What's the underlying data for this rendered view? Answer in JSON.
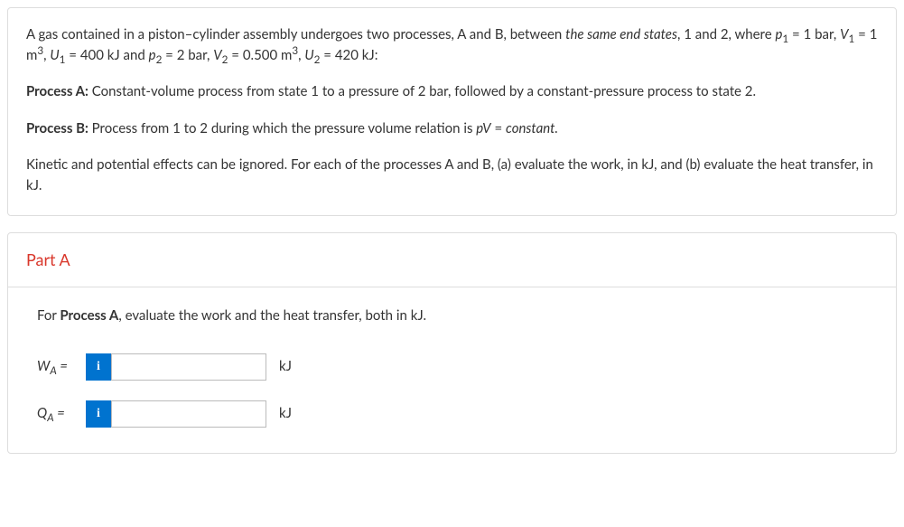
{
  "question": {
    "intro_html": "A gas contained in a piston–cylinder assembly undergoes two processes, A and B, between <span class=\"italic\">the same end states</span>, 1 and 2, where <span class=\"italic\">p</span><sub>1</sub> = 1 bar, <span class=\"italic\">V</span><sub>1</sub> = 1 m<sup>3</sup>, <span class=\"italic\">U</span><sub>1</sub> = 400 kJ and <span class=\"italic\">p</span><sub>2</sub> = 2 bar, <span class=\"italic\">V</span><sub>2</sub> = 0.500 m<sup>3</sup>, <span class=\"italic\">U</span><sub>2</sub> = 420 kJ:",
    "processA_html": "<strong>Process A:</strong> Constant-volume process from state 1 to a pressure of 2 bar, followed by a constant-pressure process to state 2.",
    "processB_html": "<strong>Process B:</strong> Process from 1 to 2 during which the pressure volume relation is <span class=\"italic\">pV</span> = <span class=\"italic\">constant.</span>",
    "closing_html": "Kinetic and potential effects can be ignored. For each of the processes A and B, (a) evaluate the work, in kJ, and (b) evaluate the heat transfer, in kJ."
  },
  "partA": {
    "title": "Part A",
    "instruction_html": "For <strong>Process A</strong>, evaluate the work and the heat transfer, both in kJ.",
    "rows": [
      {
        "label_html": "W<sub>A</sub> =",
        "value": "",
        "unit": "kJ"
      },
      {
        "label_html": "Q<sub>A</sub> =",
        "value": "",
        "unit": "kJ"
      }
    ]
  },
  "info_icon": "i"
}
